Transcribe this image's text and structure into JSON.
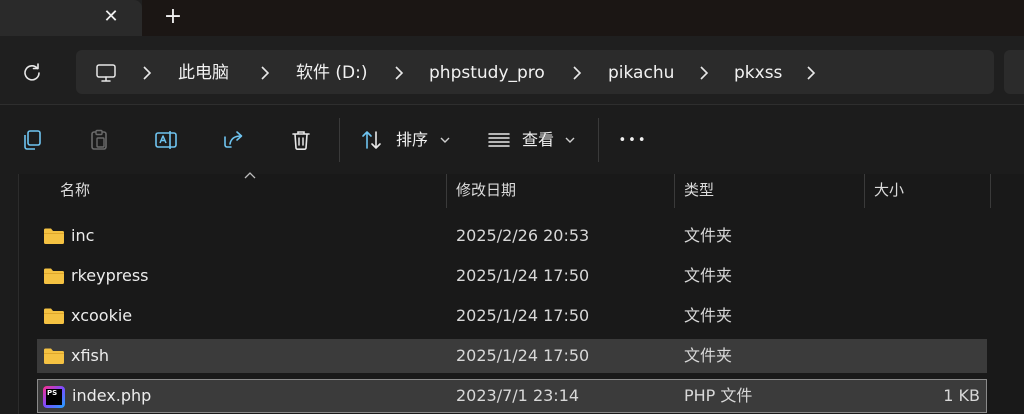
{
  "tabs": {
    "close_glyph": "✕",
    "new_tab_glyph": "+"
  },
  "breadcrumb": [
    "此电脑",
    "软件 (D:)",
    "phpstudy_pro",
    "pikachu",
    "pkxss"
  ],
  "toolbar": {
    "sort_label": "排序",
    "view_label": "查看",
    "more_glyph": "•••"
  },
  "columns": {
    "name": "名称",
    "modified": "修改日期",
    "type": "类型",
    "size": "大小"
  },
  "files": [
    {
      "name": "inc",
      "modified": "2025/2/26 20:53",
      "type": "文件夹",
      "size": "",
      "icon": "folder-icon"
    },
    {
      "name": "rkeypress",
      "modified": "2025/1/24 17:50",
      "type": "文件夹",
      "size": "",
      "icon": "folder-icon"
    },
    {
      "name": "xcookie",
      "modified": "2025/1/24 17:50",
      "type": "文件夹",
      "size": "",
      "icon": "folder-icon"
    },
    {
      "name": "xfish",
      "modified": "2025/1/24 17:50",
      "type": "文件夹",
      "size": "",
      "icon": "folder-icon"
    },
    {
      "name": "index.php",
      "modified": "2023/7/1 23:14",
      "type": "PHP 文件",
      "size": "1 KB",
      "icon": "phpstorm-file-icon",
      "icon_text": "PS"
    }
  ],
  "colors": {
    "folder": "#f5c242",
    "selection": "#3b3b3b",
    "focus_border": "#8a8a8a"
  }
}
